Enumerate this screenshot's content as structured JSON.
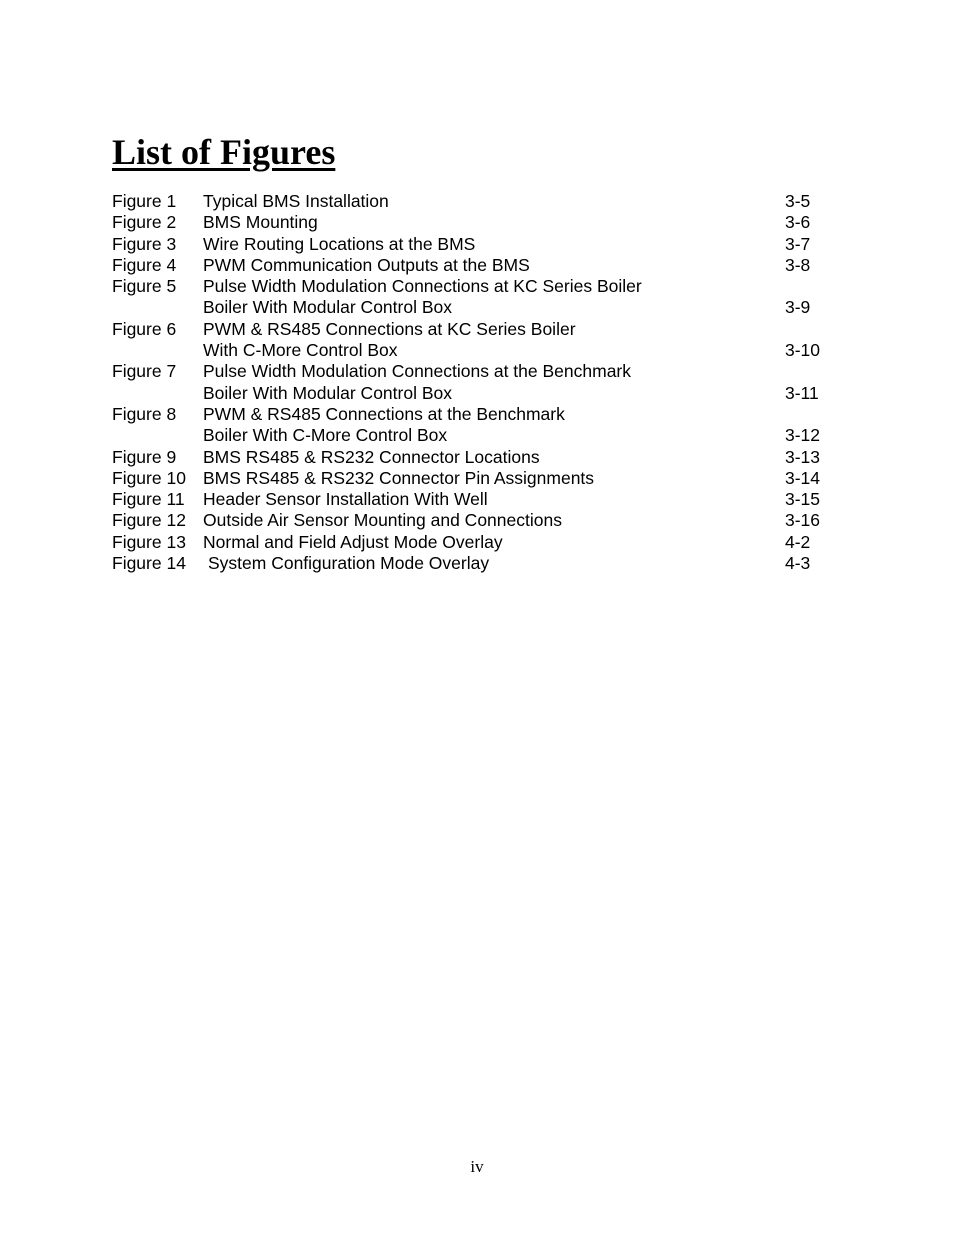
{
  "document": {
    "title": "List of Figures",
    "page_number": "iv"
  },
  "figures": [
    {
      "label": "Figure 1",
      "lines": [
        "Typical BMS Installation"
      ],
      "page": "3-5"
    },
    {
      "label": "Figure 2",
      "lines": [
        "BMS Mounting"
      ],
      "page": "3-6"
    },
    {
      "label": "Figure 3",
      "lines": [
        "Wire Routing Locations at the BMS"
      ],
      "page": "3-7"
    },
    {
      "label": "Figure 4",
      "lines": [
        "PWM Communication Outputs at the BMS"
      ],
      "page": "3-8"
    },
    {
      "label": "Figure 5",
      "lines": [
        "Pulse Width Modulation Connections at KC Series Boiler",
        "Boiler With Modular Control Box"
      ],
      "page": "3-9"
    },
    {
      "label": "Figure 6",
      "lines": [
        "PWM & RS485 Connections at KC Series Boiler",
        "With C-More Control Box"
      ],
      "page": "3-10"
    },
    {
      "label": "Figure 7",
      "lines": [
        "Pulse Width Modulation Connections at the Benchmark",
        "Boiler With Modular Control Box"
      ],
      "page": "3-11"
    },
    {
      "label": "Figure 8",
      "lines": [
        "PWM & RS485 Connections at the Benchmark",
        "Boiler With C-More Control Box"
      ],
      "page": "3-12"
    },
    {
      "label": "Figure 9",
      "lines": [
        "BMS RS485 & RS232 Connector Locations"
      ],
      "page": "3-13"
    },
    {
      "label": "Figure 10",
      "lines": [
        "BMS RS485 & RS232 Connector Pin Assignments"
      ],
      "page": "3-14"
    },
    {
      "label": "Figure 11",
      "lines": [
        "Header Sensor Installation With Well"
      ],
      "page": "3-15"
    },
    {
      "label": "Figure 12",
      "lines": [
        "Outside Air Sensor Mounting and Connections"
      ],
      "page": "3-16"
    },
    {
      "label": "Figure 13",
      "lines": [
        "Normal and Field Adjust Mode Overlay"
      ],
      "page": "4-2"
    },
    {
      "label": "Figure 14",
      "lines": [
        "System Configuration Mode Overlay"
      ],
      "page": "4-3"
    }
  ]
}
